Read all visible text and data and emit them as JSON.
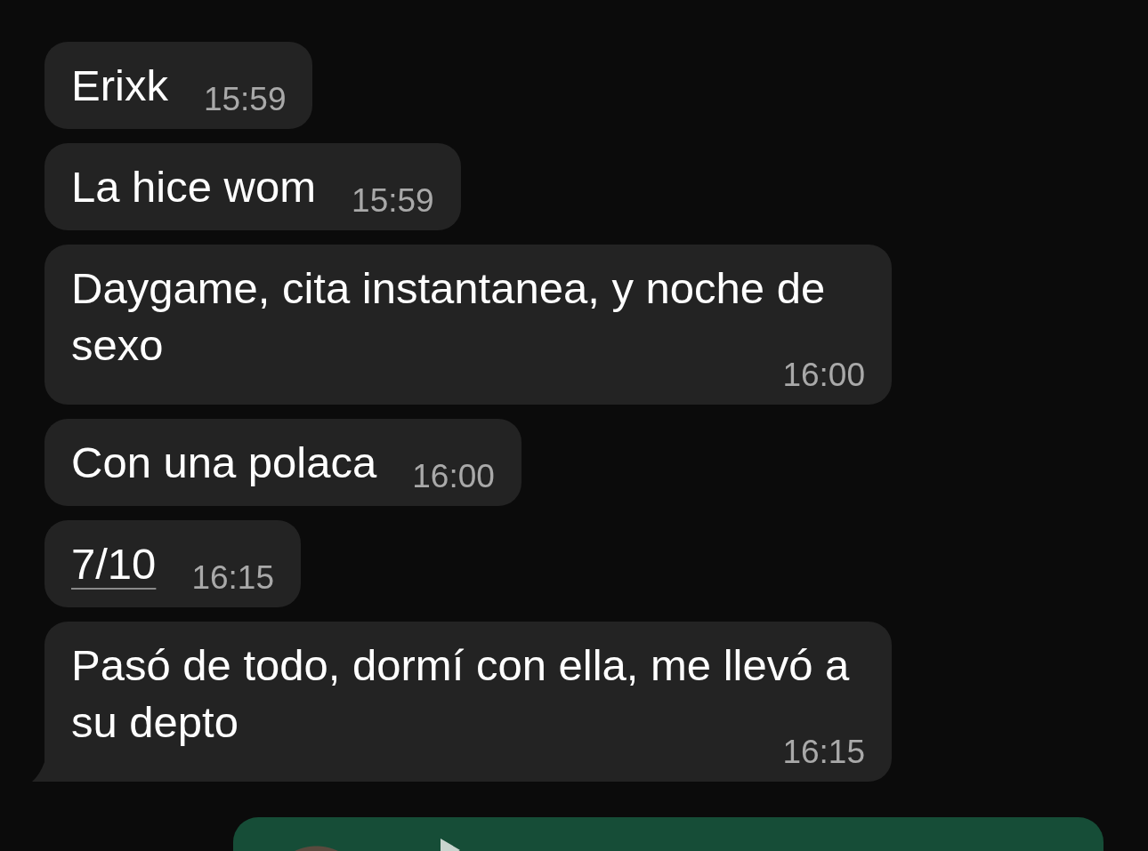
{
  "messages": [
    {
      "text": "Erixk",
      "time": "15:59",
      "link": false,
      "tail": false
    },
    {
      "text": "La hice wom",
      "time": "15:59",
      "link": false,
      "tail": false
    },
    {
      "text": "Daygame, cita instantanea, y noche de sexo",
      "time": "16:00",
      "link": false,
      "tail": false
    },
    {
      "text": "Con una polaca",
      "time": "16:00",
      "link": false,
      "tail": false
    },
    {
      "text": "7/10",
      "time": "16:15",
      "link": true,
      "tail": false
    },
    {
      "text": "Pasó de todo, dormí con ella, me llevó a su depto",
      "time": "16:15",
      "link": false,
      "tail": true
    }
  ],
  "voice_message": {
    "outgoing": true
  }
}
